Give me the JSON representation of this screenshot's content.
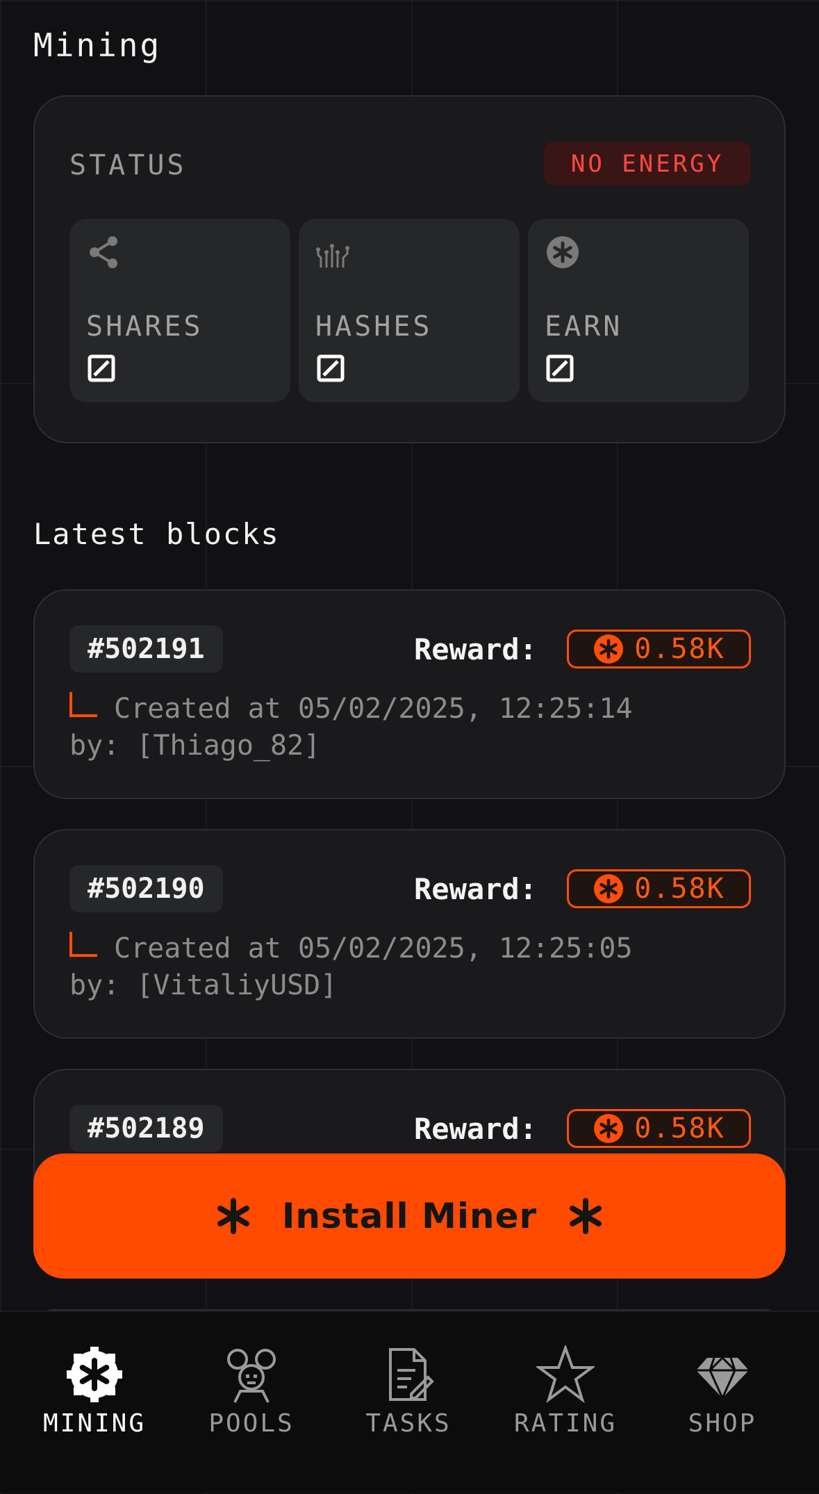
{
  "page": {
    "title": "Mining"
  },
  "status": {
    "label": "STATUS",
    "badge": "NO ENERGY",
    "tiles": [
      {
        "label": "SHARES",
        "icon": "share-icon",
        "value_icon": "empty-value-icon"
      },
      {
        "label": "HASHES",
        "icon": "circuit-icon",
        "value_icon": "empty-value-icon"
      },
      {
        "label": "EARN",
        "icon": "coin-icon",
        "value_icon": "empty-value-icon"
      }
    ]
  },
  "latest_blocks": {
    "title": "Latest blocks",
    "reward_label": "Reward:",
    "items": [
      {
        "id": "#502191",
        "reward": "0.58K",
        "created": "Created at 05/02/2025, 12:25:14",
        "by": "by: [Thiago_82]"
      },
      {
        "id": "#502190",
        "reward": "0.58K",
        "created": "Created at 05/02/2025, 12:25:05",
        "by": "by: [VitaliyUSD]"
      },
      {
        "id": "#502189",
        "reward": "0.58K",
        "created": "",
        "by": ""
      }
    ]
  },
  "install_button": {
    "label": "Install Miner"
  },
  "nav": {
    "active": "MINING",
    "items": [
      {
        "label": "MINING",
        "icon": "mining-icon"
      },
      {
        "label": "POOLS",
        "icon": "pools-icon"
      },
      {
        "label": "TASKS",
        "icon": "tasks-icon"
      },
      {
        "label": "RATING",
        "icon": "rating-icon"
      },
      {
        "label": "SHOP",
        "icon": "shop-icon"
      }
    ]
  },
  "colors": {
    "accent": "#ff4b00",
    "background": "#111113",
    "card": "#1a1a1c",
    "danger": "#ff4a3d",
    "danger_bg": "#3a1515"
  }
}
